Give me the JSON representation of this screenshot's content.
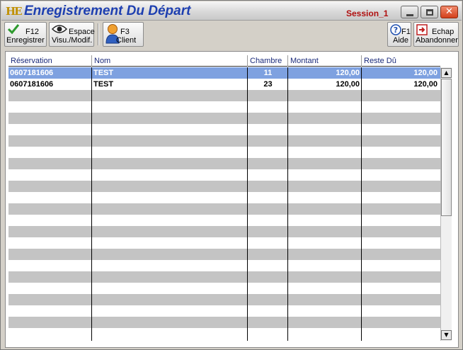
{
  "window": {
    "logo": "HE",
    "title": "Enregistrement Du Départ",
    "session": "Session_1",
    "controls": {
      "minimize": "minimize-icon",
      "maximize": "maximize-icon",
      "close": "✕"
    }
  },
  "toolbar": {
    "save": {
      "key": "F12",
      "label": "Enregistrer",
      "icon": "checkmark-icon"
    },
    "view": {
      "key": "Espace",
      "label": "Visu./Modif.",
      "icon": "eye-icon"
    },
    "client": {
      "key": "F3",
      "label": "Client",
      "icon": "person-icon"
    },
    "help": {
      "key": "F1",
      "label": "Aide",
      "icon": "help-icon"
    },
    "cancel": {
      "key": "Echap",
      "label": "Abandonner",
      "icon": "exit-icon"
    }
  },
  "table": {
    "columns": [
      "Réservation",
      "Nom",
      "Chambre",
      "Montant",
      "Reste Dû"
    ],
    "rows": [
      {
        "reservation": "0607181606",
        "nom": "TEST",
        "chambre": "11",
        "montant": "120,00",
        "reste": "120,00",
        "selected": true
      },
      {
        "reservation": "0607181606",
        "nom": "TEST",
        "chambre": "23",
        "montant": "120,00",
        "reste": "120,00",
        "selected": false
      }
    ],
    "scroll": {
      "up": "▲",
      "down": "▼"
    }
  },
  "colors": {
    "title": "#1d3fb0",
    "session": "#b01010",
    "selected_row": "#7ea1e0",
    "stripe": "#c4c4c4",
    "header_text": "#1a2a7a"
  }
}
